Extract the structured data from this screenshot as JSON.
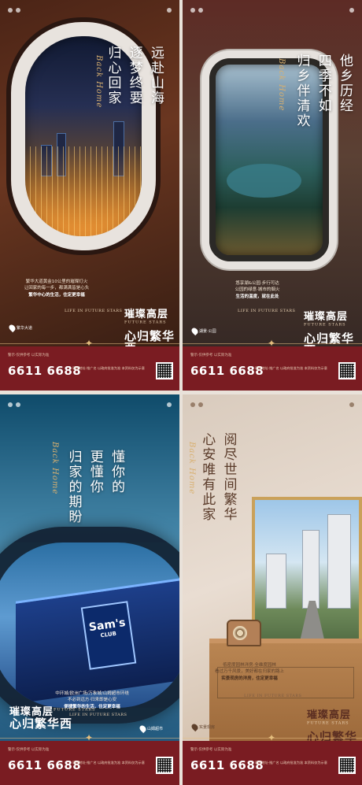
{
  "colors": {
    "footer": "#7a1c22",
    "gold": "#d8b070"
  },
  "footer": {
    "phone": "6611 6688",
    "hint": "警示·仅供参考 以实际为准",
    "info": "项目地址·推广名 以政府批准为准 本资料仅为示意"
  },
  "posters": [
    {
      "verse": [
        "远赴山海",
        "逐梦终要",
        "归心回家"
      ],
      "en": "Back Home",
      "desc_lines": [
        "繁华大道黄金10公里的璀璨灯火",
        "让回家的每一步，都满满皆是心头",
        "繁华中心的生活，住定更幸福"
      ],
      "life_en": "LIFE IN FUTURE STARS",
      "brand_line1": "璀璨高层",
      "brand_sup": "FUTURE STARS",
      "brand_line2": "心归繁华西",
      "pin": "繁华大道"
    },
    {
      "verse": [
        "他乡历经",
        "四季不如",
        "归乡伴清欢"
      ],
      "en": "Back Home",
      "desc_lines": [
        "悠享湖&公园·步行可达",
        "公园的绿意·城市的烟火",
        "生活的温度，就在此处"
      ],
      "life_en": "LIFE IN FUTURE STARS",
      "brand_line1": "璀璨高层",
      "brand_sup": "FUTURE STARS",
      "brand_line2": "心归繁华西",
      "pin": "湖景·公园"
    },
    {
      "verse": [
        "懂你的",
        "更懂你",
        "归家的期盼"
      ],
      "en": "Back Home",
      "desc_lines": [
        "中环城/欧洲广场/万象城/山姆超市环绕",
        "不必到远方·归来即是心安",
        "便捷繁华的生活，住定更幸福"
      ],
      "life_en": "LIFE IN FUTURE STARS",
      "brand_line1": "璀璨高层",
      "brand_sup": "FUTURE STARS",
      "brand_line2": "心归繁华西",
      "sams_big": "Sam's",
      "sams_small": "CLUB",
      "pin": "山姆超市"
    },
    {
      "verse": [
        "阅尽世间繁华",
        "心安唯有此家"
      ],
      "en": "Back Home",
      "desc_lines": [
        "低密度园林洋房·全维度园林",
        "看过万千风景，美好都在归家的路上",
        "实景现房的洋房，住定更幸福"
      ],
      "life_en": "LIFE IN FUTURE STARS",
      "brand_line1": "璀璨高层",
      "brand_sup": "FUTURE STARS",
      "brand_line2": "心归繁华西",
      "pin": "实景现房"
    }
  ]
}
